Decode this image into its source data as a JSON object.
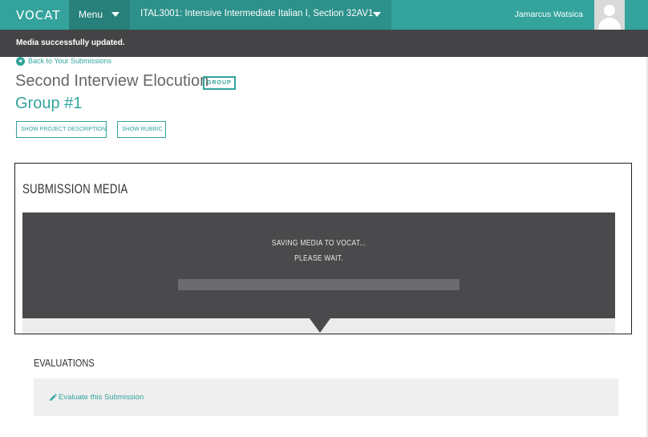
{
  "topbar": {
    "logo": "VOCAT",
    "menu_label": "Menu",
    "course_label": "ITAL3001: Intensive Intermediate Italian I, Section 32AV1",
    "username": "Jamarcus Watsica",
    "brand_color": "#33a39c"
  },
  "flash": {
    "message": "Media successfully updated."
  },
  "header": {
    "back_label": "Back to Your Submissions",
    "title": "Second Interview Elocution",
    "badge": "GROUP",
    "subtitle": "Group #1",
    "btn_description": "Show Project Description",
    "btn_rubric": "Show Rubric"
  },
  "media": {
    "heading": "SUBMISSION MEDIA",
    "status_line1": "SAVING MEDIA TO VOCAT...",
    "status_line2": "PLEASE WAIT.",
    "progress_fraction": 0
  },
  "evaluations": {
    "heading": "EVALUATIONS",
    "link_label": "Evaluate this Submission"
  }
}
